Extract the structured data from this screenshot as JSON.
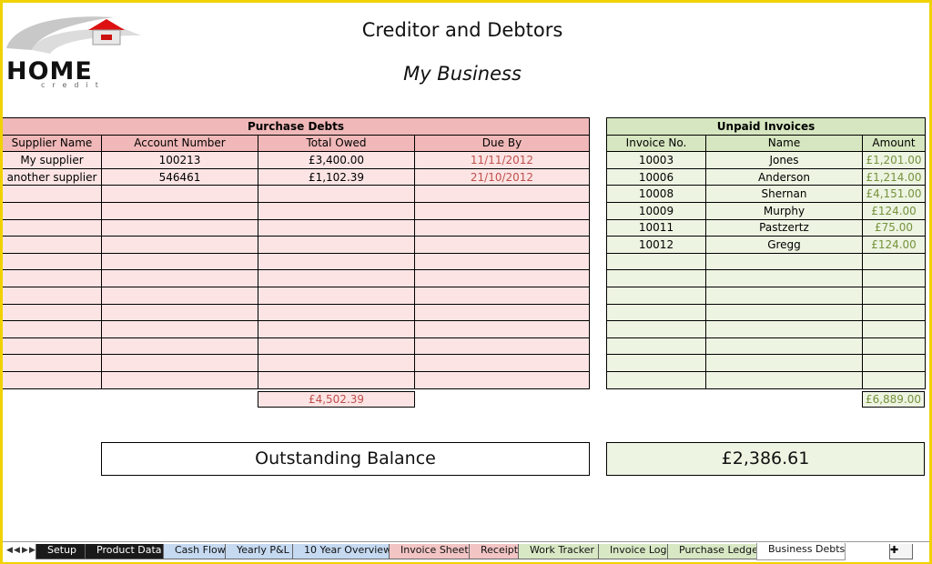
{
  "logo": {
    "word": "HOME",
    "sub": "credit"
  },
  "header": {
    "title": "Creditor and Debtors",
    "subtitle": "My Business"
  },
  "purchase_debts": {
    "title": "Purchase Debts",
    "columns": [
      "Supplier Name",
      "Account Number",
      "Total Owed",
      "Due By"
    ],
    "rows": [
      [
        "My supplier",
        "100213",
        "£3,400.00",
        "11/11/2012"
      ],
      [
        "another supplier",
        "546461",
        "£1,102.39",
        "21/10/2012"
      ],
      [
        "",
        "",
        "",
        ""
      ],
      [
        "",
        "",
        "",
        ""
      ],
      [
        "",
        "",
        "",
        ""
      ],
      [
        "",
        "",
        "",
        ""
      ],
      [
        "",
        "",
        "",
        ""
      ],
      [
        "",
        "",
        "",
        ""
      ],
      [
        "",
        "",
        "",
        ""
      ],
      [
        "",
        "",
        "",
        ""
      ],
      [
        "",
        "",
        "",
        ""
      ],
      [
        "",
        "",
        "",
        ""
      ],
      [
        "",
        "",
        "",
        ""
      ],
      [
        "",
        "",
        "",
        ""
      ]
    ],
    "total": "£4,502.39"
  },
  "unpaid_invoices": {
    "title": "Unpaid Invoices",
    "columns": [
      "Invoice No.",
      "Name",
      "Amount"
    ],
    "rows": [
      [
        "10003",
        "Jones",
        "£1,201.00"
      ],
      [
        "10006",
        "Anderson",
        "£1,214.00"
      ],
      [
        "10008",
        "Shernan",
        "£4,151.00"
      ],
      [
        "10009",
        "Murphy",
        "£124.00"
      ],
      [
        "10011",
        "Pastzertz",
        "£75.00"
      ],
      [
        "10012",
        "Gregg",
        "£124.00"
      ],
      [
        "",
        "",
        ""
      ],
      [
        "",
        "",
        ""
      ],
      [
        "",
        "",
        ""
      ],
      [
        "",
        "",
        ""
      ],
      [
        "",
        "",
        ""
      ],
      [
        "",
        "",
        ""
      ],
      [
        "",
        "",
        ""
      ],
      [
        "",
        "",
        ""
      ]
    ],
    "total": "£6,889.00"
  },
  "summary": {
    "label": "Outstanding Balance",
    "value": "£2,386.61"
  },
  "tabs": [
    {
      "label": "Setup",
      "style": "dark"
    },
    {
      "label": "Product Data",
      "style": "dark"
    },
    {
      "label": "Cash Flow",
      "style": "blue"
    },
    {
      "label": "Yearly P&L",
      "style": "blue"
    },
    {
      "label": "10 Year Overview",
      "style": "blue"
    },
    {
      "label": "Invoice Sheet",
      "style": "pink"
    },
    {
      "label": "Receipt",
      "style": "pink"
    },
    {
      "label": "Work Tracker",
      "style": "green"
    },
    {
      "label": "Invoice Log",
      "style": "green"
    },
    {
      "label": "Purchase Ledger",
      "style": "green"
    },
    {
      "label": "Business Debts",
      "style": "active"
    }
  ],
  "colors": {
    "debt_header": "#f0b8b8",
    "debt_fill": "#fce4e4",
    "invoice_header": "#d6e6c0",
    "invoice_fill": "#edf4e2",
    "date_text": "#c0504d",
    "amount_text": "#76923c"
  }
}
